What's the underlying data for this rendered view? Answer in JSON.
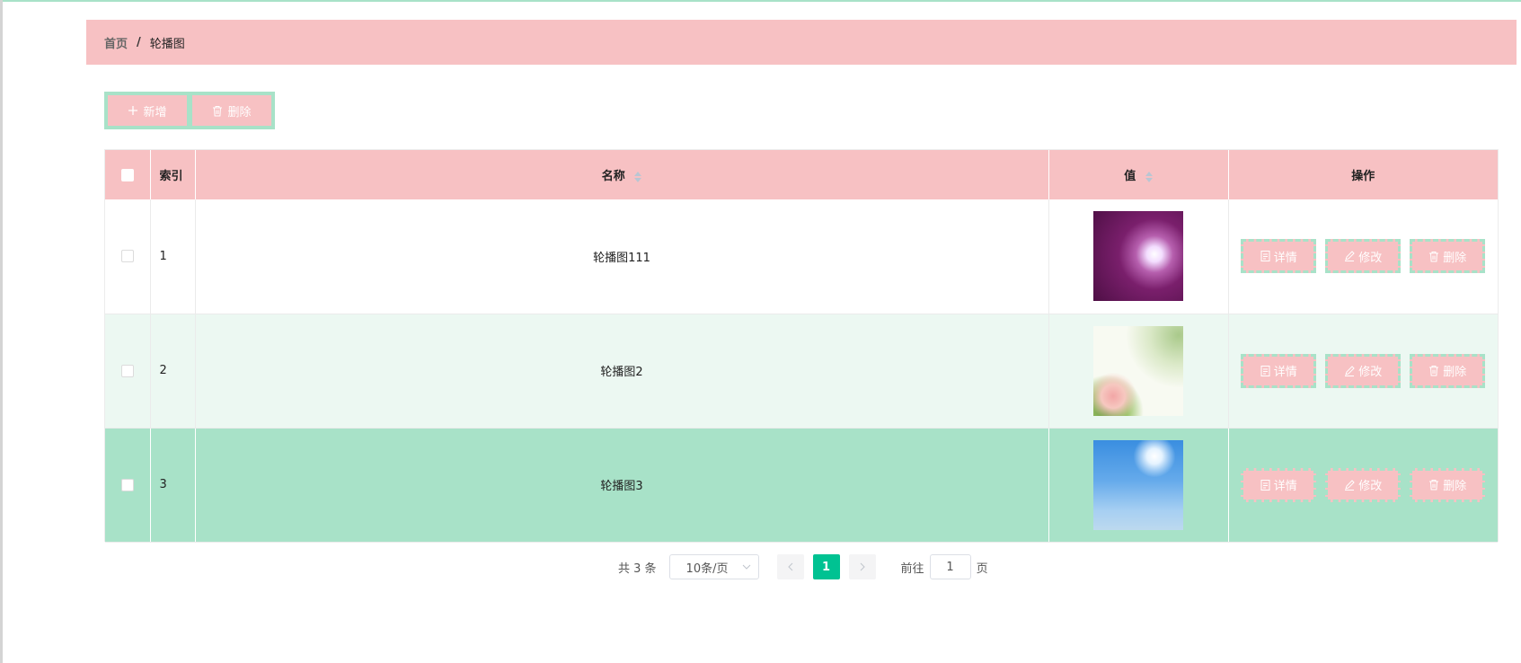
{
  "breadcrumb": {
    "home": "首页",
    "separator": "/",
    "current": "轮播图"
  },
  "toolbar": {
    "add_label": "新增",
    "add_icon": "plus-icon",
    "delete_label": "删除",
    "delete_icon": "trash-icon"
  },
  "table": {
    "headers": {
      "index": "索引",
      "name": "名称",
      "value": "值",
      "actions": "操作"
    },
    "rows": [
      {
        "index": "1",
        "name": "轮播图111",
        "image": "purple-flowers-image"
      },
      {
        "index": "2",
        "name": "轮播图2",
        "image": "lotus-flower-image"
      },
      {
        "index": "3",
        "name": "轮播图3",
        "image": "blue-sky-image"
      }
    ],
    "row_actions": {
      "detail": "详情",
      "edit": "修改",
      "delete": "删除"
    }
  },
  "pagination": {
    "total_text": "共 3 条",
    "page_size": "10条/页",
    "current_page": "1",
    "goto_label": "前往",
    "goto_value": "1",
    "page_suffix": "页"
  },
  "colors": {
    "accent_pink": "#f7c1c3",
    "accent_green": "#a8e2c8",
    "active_page": "#00c292"
  }
}
